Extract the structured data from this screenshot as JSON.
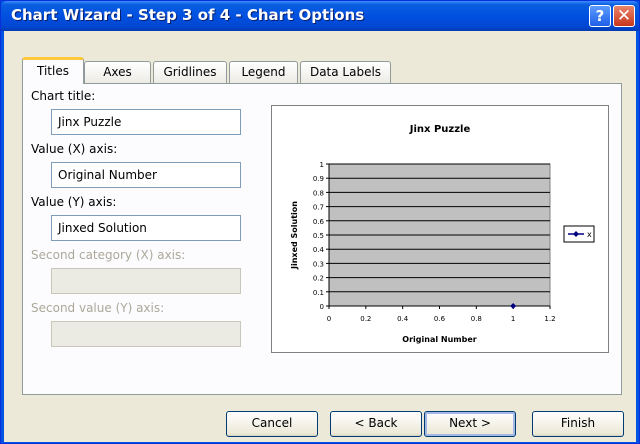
{
  "window": {
    "title": "Chart Wizard - Step 3 of 4 - Chart Options",
    "help_glyph": "?",
    "close_glyph": "✕"
  },
  "tabs": [
    {
      "label": "Titles",
      "active": true
    },
    {
      "label": "Axes",
      "active": false
    },
    {
      "label": "Gridlines",
      "active": false
    },
    {
      "label": "Legend",
      "active": false
    },
    {
      "label": "Data Labels",
      "active": false
    }
  ],
  "form": {
    "chart_title_label": "Chart title:",
    "chart_title_value": "Jinx Puzzle",
    "x_axis_label": "Value (X) axis:",
    "x_axis_value": "Original Number",
    "y_axis_label": "Value (Y) axis:",
    "y_axis_value": "Jinxed Solution",
    "second_x_label": "Second category (X) axis:",
    "second_x_value": "",
    "second_y_label": "Second value (Y) axis:",
    "second_y_value": ""
  },
  "chart_data": {
    "type": "scatter",
    "title": "Jinx Puzzle",
    "xlabel": "Original Number",
    "ylabel": "Jinxed Solution",
    "xlim": [
      0,
      1.2
    ],
    "ylim": [
      0,
      1
    ],
    "x_ticks": [
      "0",
      "0.2",
      "0.4",
      "0.6",
      "0.8",
      "1",
      "1.2"
    ],
    "y_ticks": [
      "0",
      "0.1",
      "0.2",
      "0.3",
      "0.4",
      "0.5",
      "0.6",
      "0.7",
      "0.8",
      "0.9",
      "1"
    ],
    "grid": true,
    "legend_position": "right",
    "plot_background": "#c0c0c0",
    "series": [
      {
        "name": "x",
        "color": "#000080",
        "points": [
          {
            "x": 1,
            "y": 0
          }
        ]
      }
    ]
  },
  "buttons": {
    "cancel": "Cancel",
    "back": "< Back",
    "next": "Next >",
    "finish": "Finish"
  }
}
